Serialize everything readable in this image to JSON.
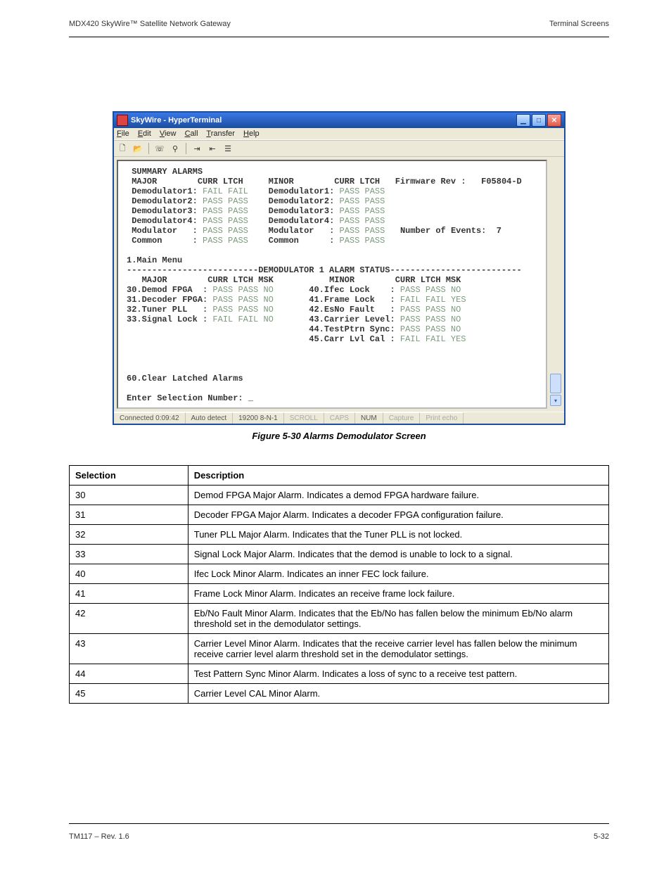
{
  "header": {
    "left": "MDX420 SkyWire™ Satellite Network Gateway",
    "right": "Terminal Screens"
  },
  "footer": {
    "left": "TM117 – Rev. 1.6",
    "right": "5-32"
  },
  "win": {
    "title": "SkyWire - HyperTerminal",
    "menu": [
      "File",
      "Edit",
      "View",
      "Call",
      "Transfer",
      "Help"
    ],
    "status": {
      "conn": "Connected 0:09:42",
      "auto": "Auto detect",
      "port": "19200 8-N-1",
      "scroll": "SCROLL",
      "caps": "CAPS",
      "num": "NUM",
      "capture": "Capture",
      "echo": "Print echo"
    }
  },
  "term": {
    "sum_title": "SUMMARY ALARMS",
    "maj": "MAJOR",
    "min": "MINOR",
    "cl": "CURR LTCH",
    "clm": "CURR LTCH MSK",
    "fw_l": "Firmware Rev :",
    "fw_v": "F05804-D",
    "ne_l": "Number of Events:",
    "ne_v": "7",
    "rows": [
      {
        "l": "Demodulator1:",
        "lv": "FAIL FAIL",
        "r": "Demodulator1:",
        "rv": "PASS PASS"
      },
      {
        "l": "Demodulator2:",
        "lv": "PASS PASS",
        "r": "Demodulator2:",
        "rv": "PASS PASS"
      },
      {
        "l": "Demodulator3:",
        "lv": "PASS PASS",
        "r": "Demodulator3:",
        "rv": "PASS PASS"
      },
      {
        "l": "Demodulator4:",
        "lv": "PASS PASS",
        "r": "Demodulator4:",
        "rv": "PASS PASS"
      },
      {
        "l": "Modulator   :",
        "lv": "PASS PASS",
        "r": "Modulator   :",
        "rv": "PASS PASS"
      },
      {
        "l": "Common      :",
        "lv": "PASS PASS",
        "r": "Common      :",
        "rv": "PASS PASS"
      }
    ],
    "mm": "1.Main Menu",
    "sep": "--------------------------DEMODULATOR 1 ALARM STATUS--------------------------",
    "major": [
      {
        "l": "30.Demod FPGA  :",
        "v": "PASS PASS NO"
      },
      {
        "l": "31.Decoder FPGA:",
        "v": "PASS PASS NO"
      },
      {
        "l": "32.Tuner PLL   :",
        "v": "PASS PASS NO"
      },
      {
        "l": "33.Signal Lock :",
        "v": "FAIL FAIL NO"
      }
    ],
    "minor": [
      {
        "l": "40.Ifec Lock    :",
        "v": "PASS PASS NO"
      },
      {
        "l": "41.Frame Lock   :",
        "v": "FAIL FAIL YES"
      },
      {
        "l": "42.EsNo Fault   :",
        "v": "PASS PASS NO"
      },
      {
        "l": "43.Carrier Level:",
        "v": "PASS PASS NO"
      },
      {
        "l": "44.TestPtrn Sync:",
        "v": "PASS PASS NO"
      },
      {
        "l": "45.Carr Lvl Cal :",
        "v": "FAIL FAIL YES"
      }
    ],
    "clear": "60.Clear Latched Alarms",
    "prompt": "Enter Selection Number: _"
  },
  "figure": "Figure 5-30 Alarms Demodulator Screen",
  "table": {
    "h1": "Selection",
    "h2": "Description",
    "rows": [
      [
        "30",
        "Demod FPGA Major Alarm.  Indicates a demod FPGA hardware failure."
      ],
      [
        "31",
        "Decoder FPGA Major Alarm.  Indicates a decoder FPGA configuration failure."
      ],
      [
        "32",
        "Tuner PLL Major Alarm.  Indicates that the Tuner PLL is not locked."
      ],
      [
        "33",
        "Signal Lock Major Alarm.  Indicates that the demod is unable to lock to a signal."
      ],
      [
        "40",
        "Ifec Lock Minor Alarm.  Indicates an inner FEC lock failure."
      ],
      [
        "41",
        "Frame Lock Minor Alarm.  Indicates an receive frame lock failure."
      ],
      [
        "42",
        "Eb/No Fault Minor Alarm.  Indicates that the Eb/No has fallen below the minimum Eb/No alarm threshold set in the demodulator settings."
      ],
      [
        "43",
        "Carrier Level Minor Alarm.  Indicates that the receive carrier level has fallen below the minimum receive carrier level alarm threshold set in the demodulator settings."
      ],
      [
        "44",
        "Test Pattern Sync Minor Alarm.  Indicates a loss of sync to a receive test pattern."
      ],
      [
        "45",
        "Carrier Level CAL Minor Alarm."
      ]
    ]
  }
}
